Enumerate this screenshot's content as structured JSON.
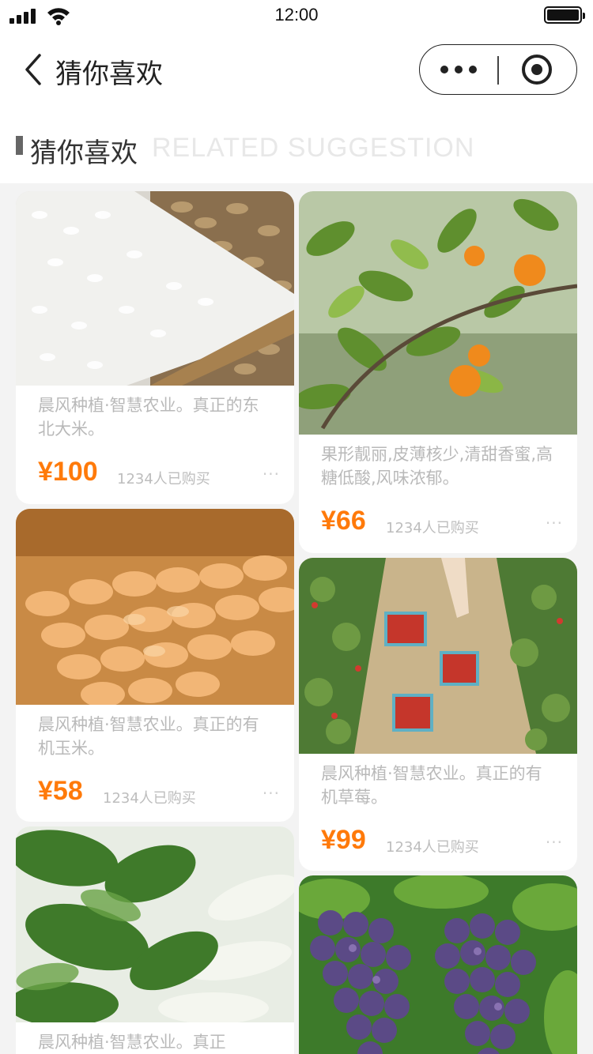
{
  "status_bar": {
    "time": "12:00"
  },
  "nav": {
    "title": "猜你喜欢"
  },
  "section": {
    "title": "猜你喜欢",
    "subtitle": "RELATED SUGGESTION"
  },
  "products": [
    {
      "desc": "晨风种植·智慧农业。真正的东北大米。",
      "price": "¥100",
      "sold": "1234人已购买",
      "more": "···"
    },
    {
      "desc": "果形靓丽,皮薄核少,清甜香蜜,高糖低酸,风味浓郁。",
      "price": "¥66",
      "sold": "1234人已购买",
      "more": "···"
    },
    {
      "desc": "晨风种植·智慧农业。真正的有机玉米。",
      "price": "¥58",
      "sold": "1234人已购买",
      "more": "···"
    },
    {
      "desc": "晨风种植·智慧农业。真正的有机草莓。",
      "price": "¥99",
      "sold": "1234人已购买",
      "more": "···"
    },
    {
      "desc": "晨风种植·智慧农业。真正",
      "price": "",
      "sold": "",
      "more": ""
    },
    {
      "desc": "",
      "price": "",
      "sold": "",
      "more": ""
    }
  ],
  "colors": {
    "price": "#ff7a0a",
    "text_muted": "#b9b9b9",
    "background": "#f3f3f3"
  },
  "icons": [
    "signal-icon",
    "wifi-icon",
    "battery-icon",
    "back-arrow-icon",
    "more-dots-icon",
    "close-miniprogram-icon"
  ]
}
